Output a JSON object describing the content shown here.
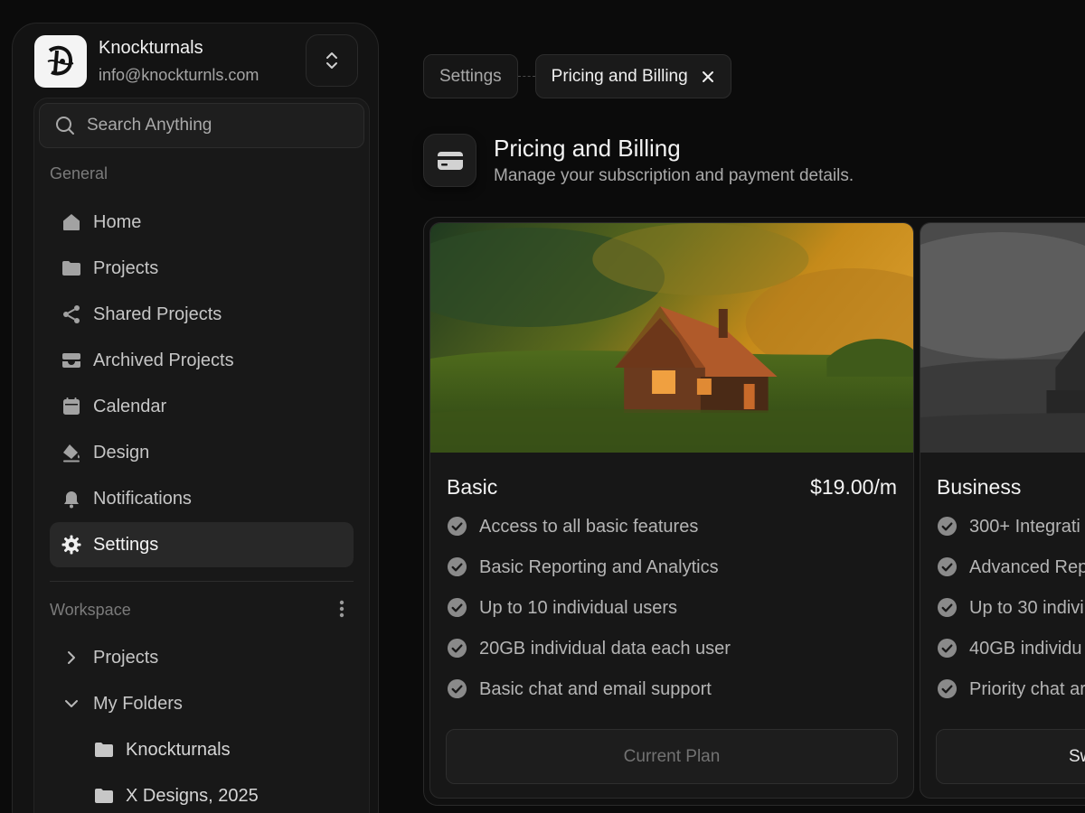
{
  "account": {
    "name": "Knockturnals",
    "email": "info@knockturnls.com"
  },
  "search": {
    "placeholder": "Search Anything"
  },
  "sidebar": {
    "general_label": "General",
    "items": [
      {
        "label": "Home",
        "icon": "home-icon"
      },
      {
        "label": "Projects",
        "icon": "folder-icon"
      },
      {
        "label": "Shared Projects",
        "icon": "share-icon"
      },
      {
        "label": "Archived Projects",
        "icon": "archive-icon"
      },
      {
        "label": "Calendar",
        "icon": "calendar-icon"
      },
      {
        "label": "Design",
        "icon": "paint-bucket-icon"
      },
      {
        "label": "Notifications",
        "icon": "bell-icon"
      },
      {
        "label": "Settings",
        "icon": "gear-icon",
        "active": true
      }
    ],
    "workspace_label": "Workspace",
    "workspace_items": [
      {
        "label": "Projects",
        "icon": "chevron-right-icon"
      },
      {
        "label": "My Folders",
        "icon": "chevron-down-icon"
      },
      {
        "label": "Knockturnals",
        "icon": "folder-icon"
      },
      {
        "label": "X Designs, 2025",
        "icon": "folder-icon"
      }
    ]
  },
  "breadcrumbs": [
    "Settings",
    "Pricing and Billing"
  ],
  "header": {
    "title": "Pricing and Billing",
    "subtitle": "Manage your subscription and payment details."
  },
  "plans": [
    {
      "name": "Basic",
      "price": "$19.00/m",
      "features": [
        "Access to all basic features",
        "Basic Reporting and Analytics",
        "Up to 10 individual users",
        "20GB individual data each user",
        "Basic chat and email support"
      ],
      "button": "Current Plan"
    },
    {
      "name": "Business",
      "features": [
        "300+ Integrati",
        "Advanced Rep",
        "Up to 30 indivi",
        "40GB individu",
        "Priority chat ar"
      ],
      "button": "Sw"
    }
  ],
  "colors": {
    "background": "#0b0b0b",
    "panel": "#131313",
    "accent_active": "#282828",
    "check": "#8a8a8a"
  }
}
